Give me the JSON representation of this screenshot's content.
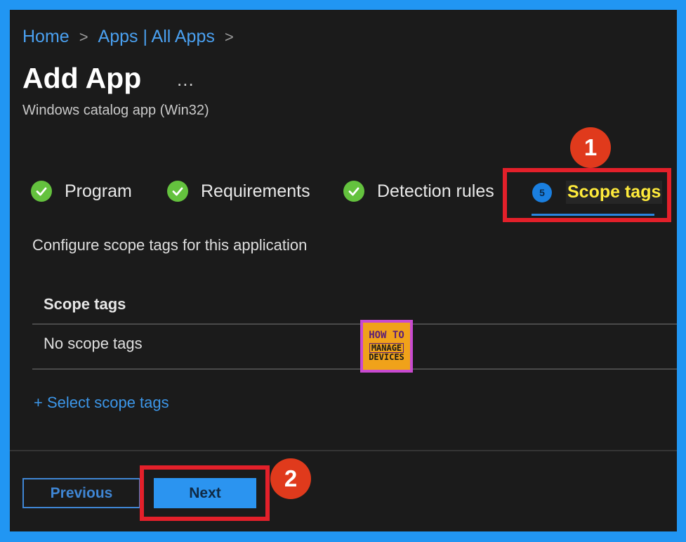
{
  "breadcrumb": {
    "items": [
      "Home",
      "Apps | All Apps"
    ],
    "separator": ">"
  },
  "page": {
    "title": "Add App",
    "more_label": "...",
    "subtitle": "Windows catalog app (Win32)"
  },
  "steps": [
    {
      "label": "Program",
      "status": "complete"
    },
    {
      "label": "Requirements",
      "status": "complete"
    },
    {
      "label": "Detection rules",
      "status": "complete"
    },
    {
      "label": "Scope tags",
      "status": "current",
      "number": "5"
    }
  ],
  "content": {
    "description": "Configure scope tags for this application",
    "table_header": "Scope tags",
    "empty_value": "No scope tags",
    "select_link": "+ Select scope tags"
  },
  "footer": {
    "previous_label": "Previous",
    "next_label": "Next"
  },
  "annotations": {
    "badge_1": "1",
    "badge_2": "2",
    "highlight_color": "#e3202a"
  },
  "watermark": {
    "line1": "HOW TO",
    "line2": "MANAGE",
    "line3": "DEVICES"
  },
  "colors": {
    "accent": "#2b94f0",
    "success": "#64c23e",
    "active_tab_text": "#ffeb3b",
    "frame": "#2196f3"
  }
}
